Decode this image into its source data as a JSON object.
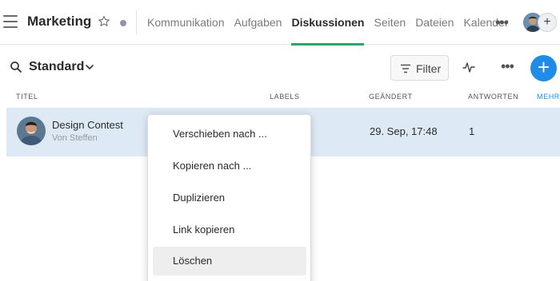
{
  "header": {
    "title": "Marketing",
    "tabs": [
      {
        "label": "Kommunikation",
        "active": false
      },
      {
        "label": "Aufgaben",
        "active": false
      },
      {
        "label": "Diskussionen",
        "active": true
      },
      {
        "label": "Seiten",
        "active": false
      },
      {
        "label": "Dateien",
        "active": false
      },
      {
        "label": "Kalender",
        "active": false
      }
    ],
    "more": "•••",
    "add_member": "+"
  },
  "toolbar": {
    "view_name": "Standard",
    "filter_label": "Filter",
    "more": "•••",
    "add": "+"
  },
  "table": {
    "columns": [
      "Titel",
      "Labels",
      "Geändert",
      "Antworten",
      "Mehr"
    ],
    "rows": [
      {
        "title": "Design Contest",
        "author": "Von Steffen",
        "labels": "",
        "changed": "29. Sep, 17:48",
        "replies": "1"
      }
    ]
  },
  "context_menu": {
    "items": [
      "Verschieben nach ...",
      "Kopieren nach ...",
      "Duplizieren",
      "Link kopieren",
      "Löschen"
    ],
    "highlighted_index": 4
  },
  "colors": {
    "accent_green": "#2ea46a",
    "primary_blue": "#1f8de8",
    "row_selected": "#dde9f4"
  },
  "icons": [
    "hamburger-icon",
    "star-icon",
    "search-icon",
    "chevron-down-icon",
    "filter-icon",
    "activity-icon",
    "more-icon",
    "plus-icon"
  ]
}
